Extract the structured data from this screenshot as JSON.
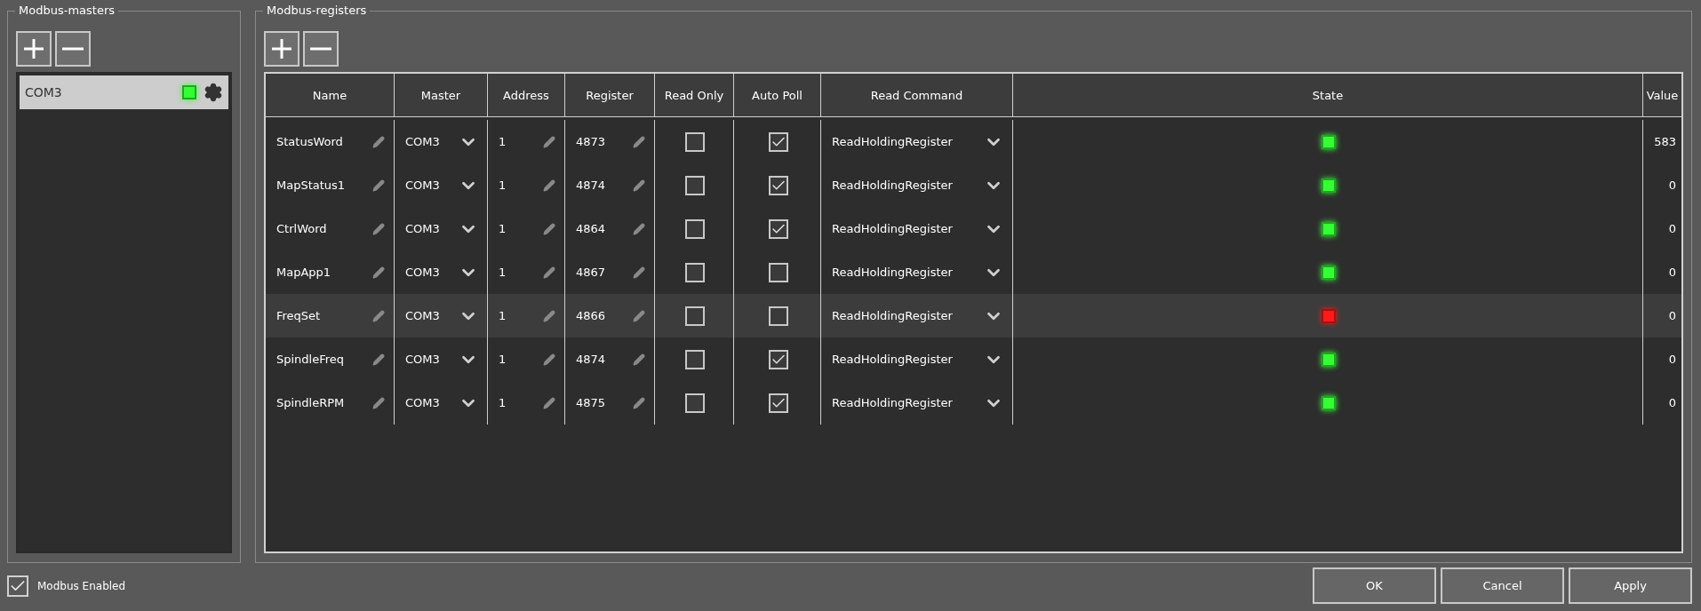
{
  "masters_panel": {
    "title": "Modbus-masters",
    "items": [
      {
        "name": "COM3",
        "selected": true,
        "color": "#33ff33"
      }
    ]
  },
  "registers_panel": {
    "title": "Modbus-registers",
    "columns": [
      "Name",
      "Master",
      "Address",
      "Register",
      "Read Only",
      "Auto Poll",
      "Read Command",
      "State",
      "Value"
    ],
    "rows": [
      {
        "name": "StatusWord",
        "master": "COM3",
        "address": "1",
        "register": "4873",
        "read_only": false,
        "auto_poll": true,
        "read_command": "ReadHoldingRegister",
        "color": "#33ff33",
        "value": "583",
        "selected": false
      },
      {
        "name": "MapStatus1",
        "master": "COM3",
        "address": "1",
        "register": "4874",
        "read_only": false,
        "auto_poll": true,
        "read_command": "ReadHoldingRegister",
        "color": "#33ff33",
        "value": "0",
        "selected": false
      },
      {
        "name": "CtrlWord",
        "master": "COM3",
        "address": "1",
        "register": "4864",
        "read_only": false,
        "auto_poll": true,
        "read_command": "ReadHoldingRegister",
        "color": "#33ff33",
        "value": "0",
        "selected": false
      },
      {
        "name": "MapApp1",
        "master": "COM3",
        "address": "1",
        "register": "4867",
        "read_only": false,
        "auto_poll": false,
        "read_command": "ReadHoldingRegister",
        "color": "#33ff33",
        "value": "0",
        "selected": false
      },
      {
        "name": "FreqSet",
        "master": "COM3",
        "address": "1",
        "register": "4866",
        "read_only": false,
        "auto_poll": false,
        "read_command": "ReadHoldingRegister",
        "color": "#ff1a1a",
        "value": "0",
        "selected": true
      },
      {
        "name": "SpindleFreq",
        "master": "COM3",
        "address": "1",
        "register": "4874",
        "read_only": false,
        "auto_poll": true,
        "read_command": "ReadHoldingRegister",
        "color": "#33ff33",
        "value": "0",
        "selected": false
      },
      {
        "name": "SpindleRPM",
        "master": "COM3",
        "address": "1",
        "register": "4875",
        "read_only": false,
        "auto_poll": true,
        "read_command": "ReadHoldingRegister",
        "color": "#33ff33",
        "value": "0",
        "selected": false
      }
    ]
  },
  "modbus_enabled": {
    "label": "Modbus Enabled",
    "checked": true
  },
  "buttons": [
    "OK",
    "Cancel",
    "Apply"
  ]
}
